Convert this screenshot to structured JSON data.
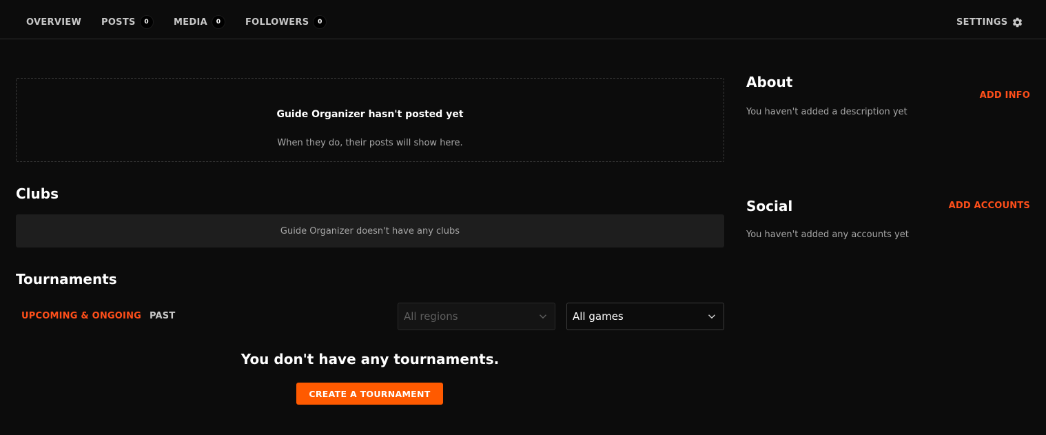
{
  "nav": {
    "overview": "OVERVIEW",
    "posts": "POSTS",
    "posts_count": "0",
    "media": "MEDIA",
    "media_count": "0",
    "followers": "FOLLOWERS",
    "followers_count": "0",
    "settings": "SETTINGS"
  },
  "posts_empty": {
    "title": "Guide Organizer hasn't posted yet",
    "subtitle": "When they do, their posts will show here."
  },
  "clubs": {
    "title": "Clubs",
    "empty": "Guide Organizer doesn't have any clubs"
  },
  "tournaments": {
    "title": "Tournaments",
    "tabs": [
      "UPCOMING & ONGOING",
      "PAST"
    ],
    "active_tab": "UPCOMING & ONGOING",
    "region_select": {
      "value": "All regions",
      "disabled": true
    },
    "game_select": {
      "value": "All games",
      "disabled": false
    },
    "empty": "You don't have any tournaments.",
    "create_button": "CREATE A TOURNAMENT"
  },
  "about": {
    "title": "About",
    "action": "ADD INFO",
    "text": "You haven't added a description yet"
  },
  "social": {
    "title": "Social",
    "action": "ADD ACCOUNTS",
    "text": "You haven't added any accounts yet"
  },
  "colors": {
    "accent": "#ff4f1a",
    "button": "#ff5a00",
    "background": "#0c0c0c",
    "panel": "#1e1e1e"
  }
}
